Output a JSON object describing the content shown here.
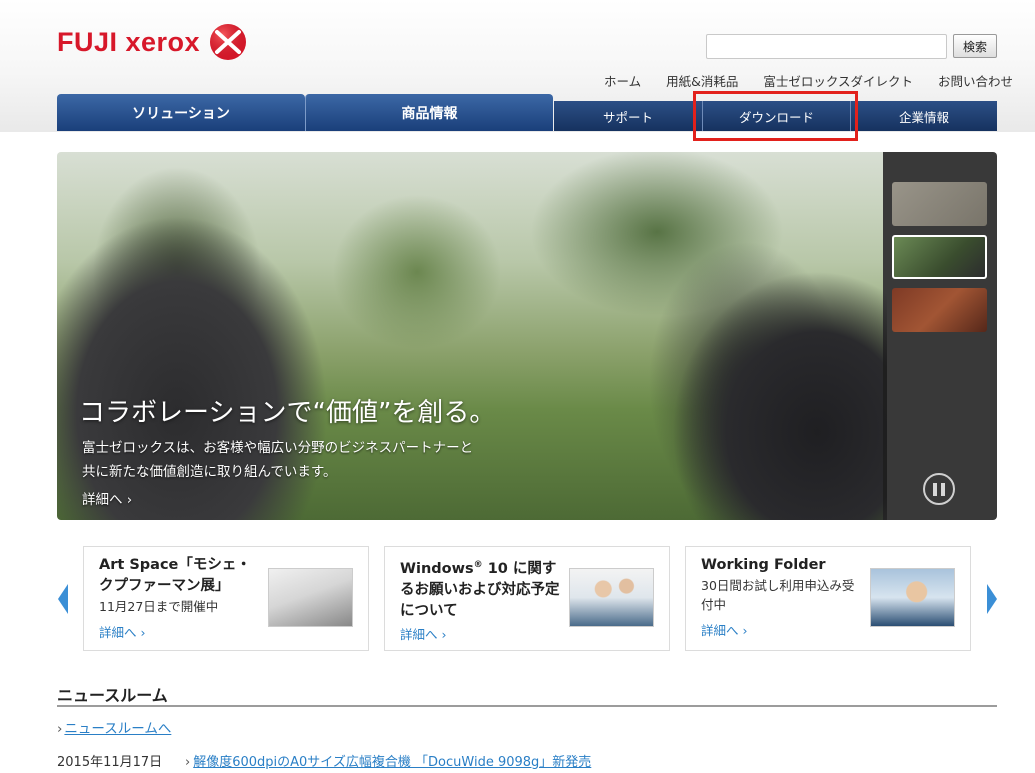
{
  "brand": {
    "logo_text": "FUJI xerox",
    "accent": "#d7182a"
  },
  "search": {
    "placeholder": "",
    "button_label": "検索"
  },
  "util_nav": [
    "ホーム",
    "用紙&消耗品",
    "富士ゼロックスダイレクト",
    "お問い合わせ"
  ],
  "main_nav": {
    "items": [
      "ソリューション",
      "商品情報",
      "サポート",
      "ダウンロード",
      "企業情報"
    ],
    "highlighted": "ダウンロード",
    "colors": {
      "primary": "#2c5590",
      "highlight_border": "#e2211c"
    }
  },
  "hero": {
    "title": "コラボレーションで“価値”を創る。",
    "description_line1": "富士ゼロックスは、お客様や幅広い分野のビジネスパートナーと",
    "description_line2": "共に新たな価値創造に取り組んでいます。",
    "more_label": "詳細へ ›",
    "thumbnails": [
      "pen-and-document-icon",
      "collaboration-circle-icon",
      "running-track-icon"
    ],
    "active_thumbnail": 1
  },
  "cards": [
    {
      "title": "Art Space「モシェ・クプファーマン展」",
      "subtitle": "11月27日まで開催中",
      "more": "詳細へ ›"
    },
    {
      "title_main": "Windows",
      "title_sup": "®",
      "title_rest": " 10 に関するお願いおよび対応予定について",
      "subtitle": "",
      "more": "詳細へ ›"
    },
    {
      "title": "Working Folder",
      "subtitle": "30日間お試し利用申込み受付中",
      "more": "詳細へ ›"
    }
  ],
  "news": {
    "heading": "ニュースルーム",
    "all_link": "ニュースルームへ",
    "items": [
      {
        "date": "2015年11月17日",
        "title": "解像度600dpiのA0サイズ広幅複合機 「DocuWide 9098g」新発売"
      }
    ]
  }
}
